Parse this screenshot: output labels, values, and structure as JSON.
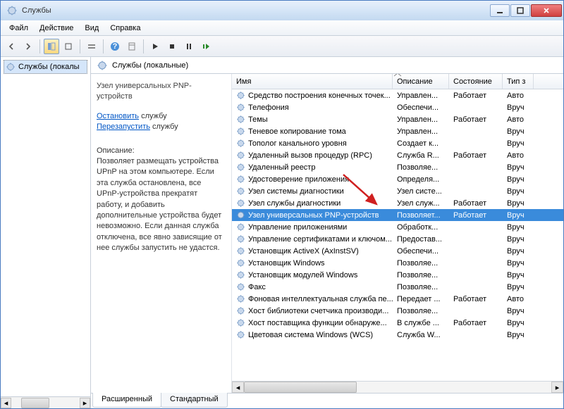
{
  "window": {
    "title": "Службы"
  },
  "menu": [
    "Файл",
    "Действие",
    "Вид",
    "Справка"
  ],
  "tree": {
    "root": "Службы (локалы"
  },
  "header": {
    "label": "Службы (локальные)"
  },
  "detail": {
    "title": "Узел универсальных PNP-устройств",
    "stop_link": "Остановить",
    "stop_tail": " службу",
    "restart_link": "Перезапустить",
    "restart_tail": " службу",
    "desc_label": "Описание:",
    "description": "Позволяет размещать устройства UPnP на этом компьютере. Если эта служба остановлена, все UPnP-устройства прекратят работу, и добавить дополнительные устройства будет невозможно. Если данная служба отключена, все явно зависящие от нее службы запустить не удастся."
  },
  "columns": {
    "name": "Имя",
    "desc": "Описание",
    "state": "Состояние",
    "type": "Тип з"
  },
  "tabs": {
    "ext": "Расширенный",
    "std": "Стандартный"
  },
  "col_widths": {
    "name": 228,
    "desc": 80,
    "state": 76,
    "type": 44
  },
  "services": [
    {
      "name": "Средство построения конечных точек...",
      "desc": "Управлен...",
      "state": "Работает",
      "type": "Авто"
    },
    {
      "name": "Телефония",
      "desc": "Обеспечи...",
      "state": "",
      "type": "Вруч"
    },
    {
      "name": "Темы",
      "desc": "Управлен...",
      "state": "Работает",
      "type": "Авто"
    },
    {
      "name": "Теневое копирование тома",
      "desc": "Управлен...",
      "state": "",
      "type": "Вруч"
    },
    {
      "name": "Тополог канального уровня",
      "desc": "Создает к...",
      "state": "",
      "type": "Вруч"
    },
    {
      "name": "Удаленный вызов процедур (RPC)",
      "desc": "Служба R...",
      "state": "Работает",
      "type": "Авто"
    },
    {
      "name": "Удаленный реестр",
      "desc": "Позволяе...",
      "state": "",
      "type": "Вруч"
    },
    {
      "name": "Удостоверение приложения",
      "desc": "Определя...",
      "state": "",
      "type": "Вруч"
    },
    {
      "name": "Узел системы диагностики",
      "desc": "Узел систе...",
      "state": "",
      "type": "Вруч"
    },
    {
      "name": "Узел службы диагностики",
      "desc": "Узел служ...",
      "state": "Работает",
      "type": "Вруч"
    },
    {
      "name": "Узел универсальных PNP-устройств",
      "desc": "Позволяет...",
      "state": "Работает",
      "type": "Вруч",
      "selected": true
    },
    {
      "name": "Управление приложениями",
      "desc": "Обработк...",
      "state": "",
      "type": "Вруч"
    },
    {
      "name": "Управление сертификатами и ключом...",
      "desc": "Предостав...",
      "state": "",
      "type": "Вруч"
    },
    {
      "name": "Установщик ActiveX (AxInstSV)",
      "desc": "Обеспечи...",
      "state": "",
      "type": "Вруч"
    },
    {
      "name": "Установщик Windows",
      "desc": "Позволяе...",
      "state": "",
      "type": "Вруч"
    },
    {
      "name": "Установщик модулей Windows",
      "desc": "Позволяе...",
      "state": "",
      "type": "Вруч"
    },
    {
      "name": "Факс",
      "desc": "Позволяе...",
      "state": "",
      "type": "Вруч"
    },
    {
      "name": "Фоновая интеллектуальная служба пе...",
      "desc": "Передает ...",
      "state": "Работает",
      "type": "Авто"
    },
    {
      "name": "Хост библиотеки счетчика производи...",
      "desc": "Позволяе...",
      "state": "",
      "type": "Вруч"
    },
    {
      "name": "Хост поставщика функции обнаруже...",
      "desc": "В службе ...",
      "state": "Работает",
      "type": "Вруч"
    },
    {
      "name": "Цветовая система Windows (WCS)",
      "desc": "Служба W...",
      "state": "",
      "type": "Вруч"
    }
  ]
}
